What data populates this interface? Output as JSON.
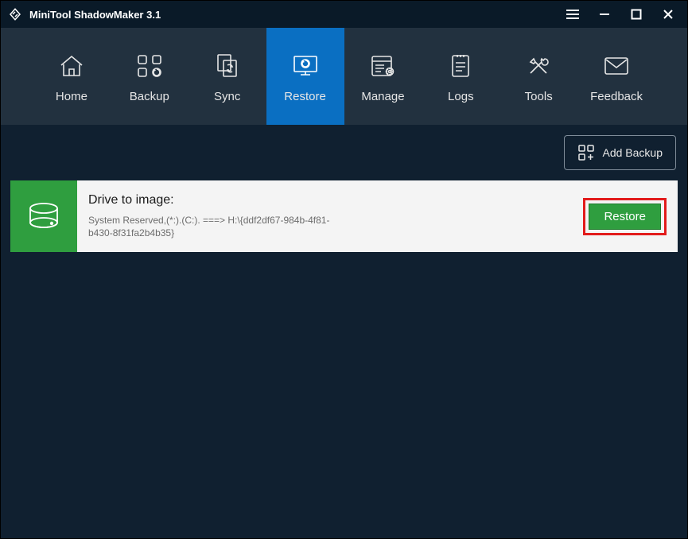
{
  "app": {
    "title": "MiniTool ShadowMaker 3.1"
  },
  "nav": {
    "items": [
      {
        "label": "Home"
      },
      {
        "label": "Backup"
      },
      {
        "label": "Sync"
      },
      {
        "label": "Restore"
      },
      {
        "label": "Manage"
      },
      {
        "label": "Logs"
      },
      {
        "label": "Tools"
      },
      {
        "label": "Feedback"
      }
    ]
  },
  "toolbar": {
    "add_backup_label": "Add Backup"
  },
  "card": {
    "title": "Drive to image:",
    "detail": "System Reserved,(*:).(C:). ===> H:\\{ddf2df67-984b-4f81-b430-8f31fa2b4b35}",
    "restore_label": "Restore"
  }
}
